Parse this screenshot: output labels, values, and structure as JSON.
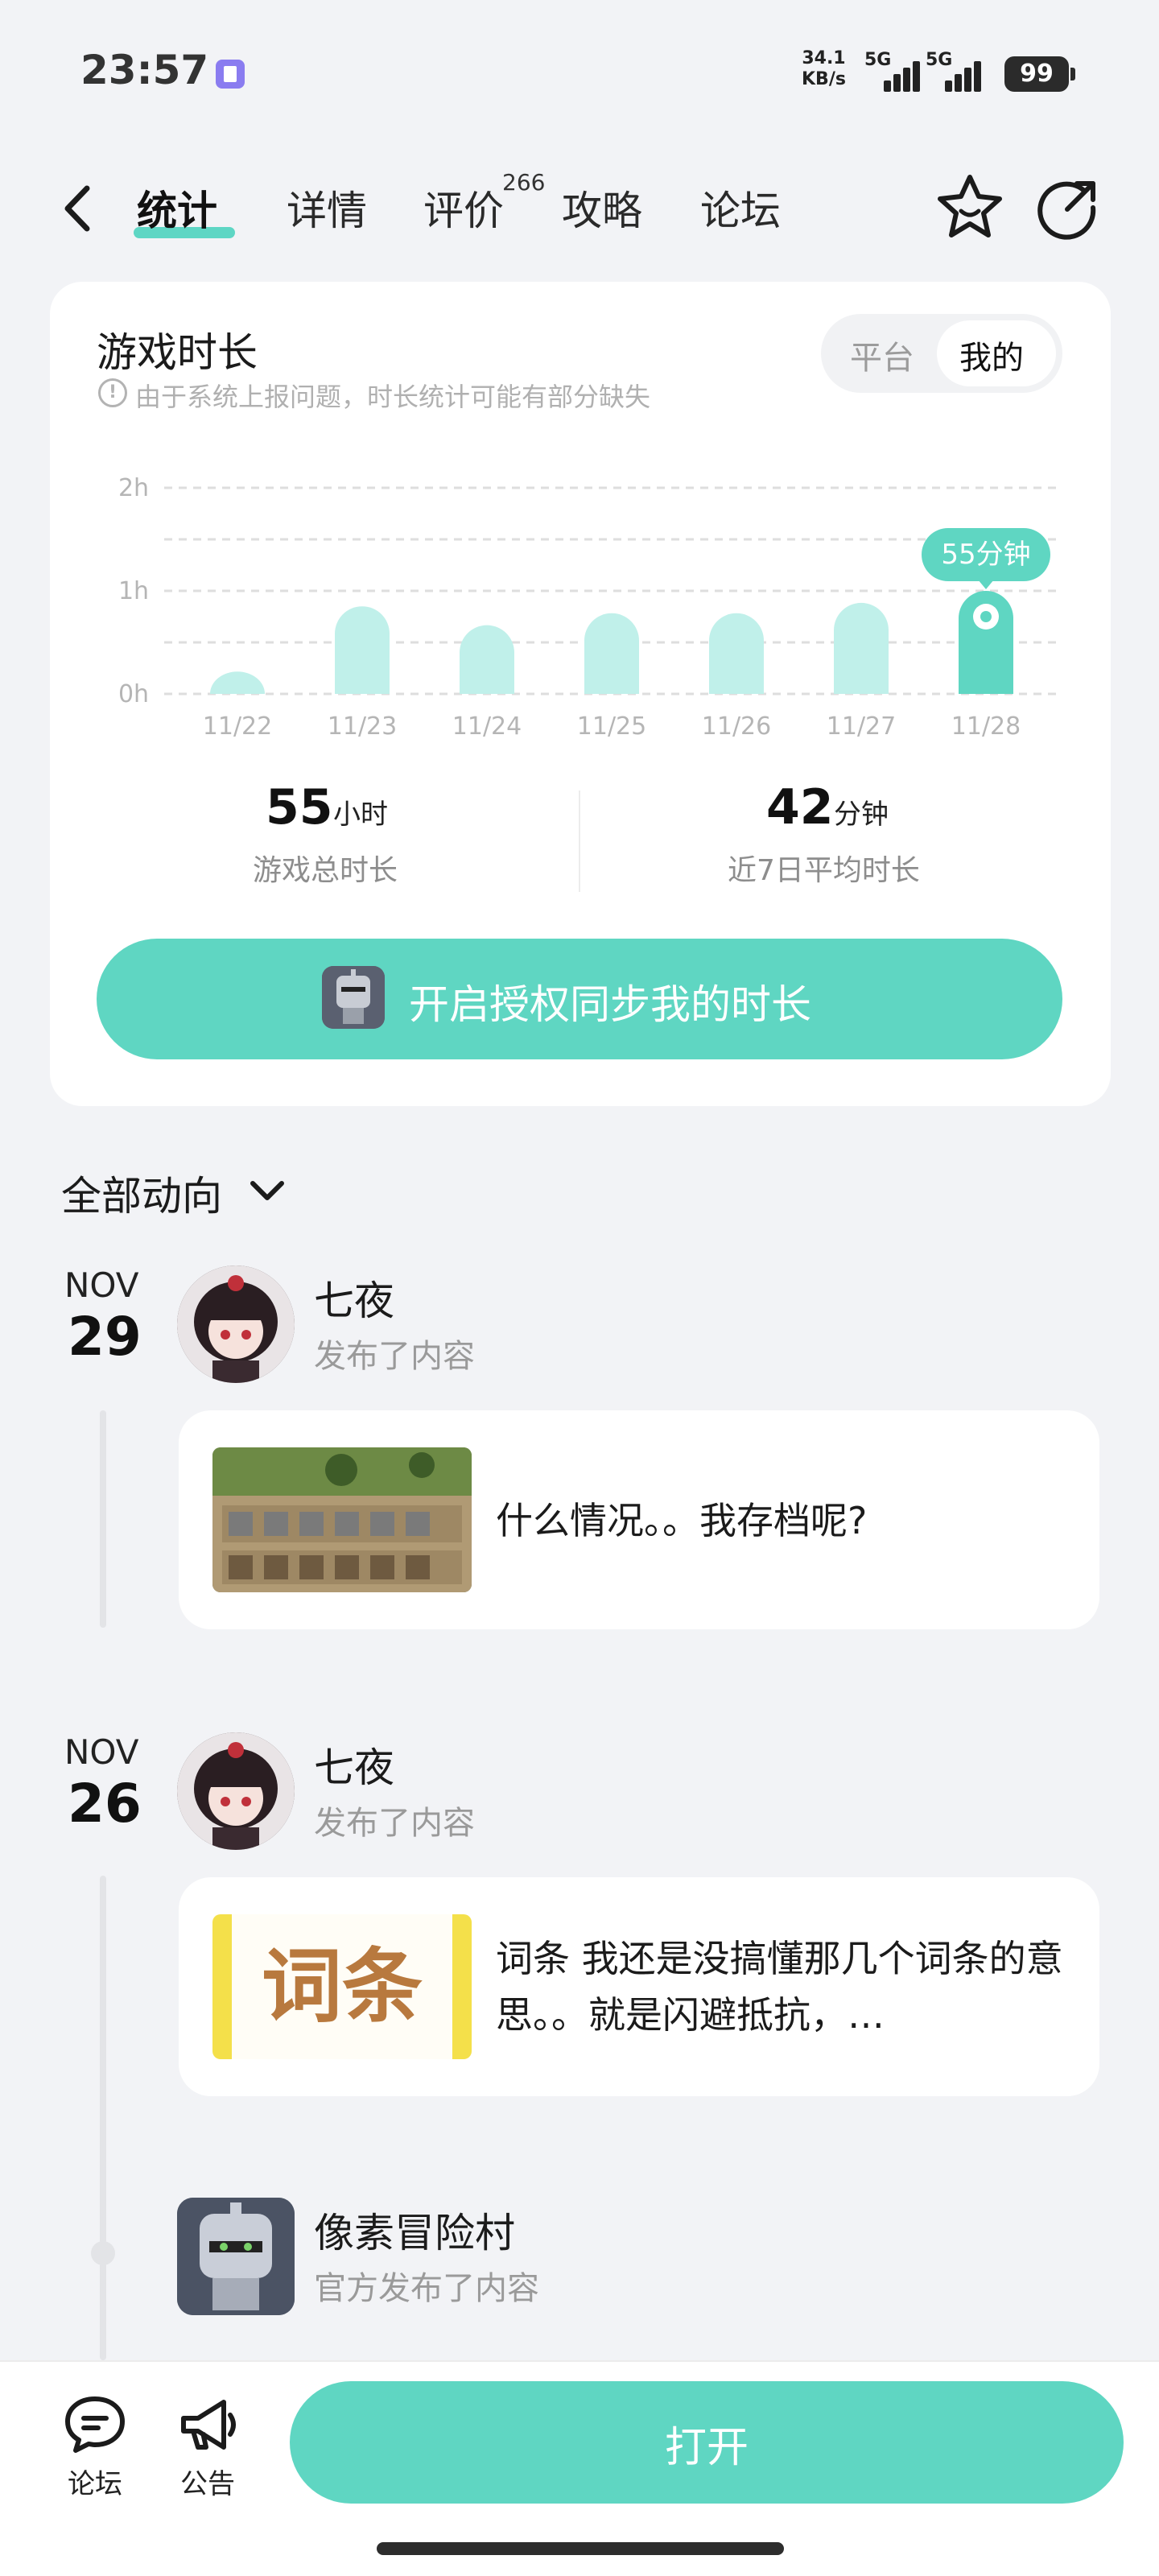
{
  "status_bar": {
    "time": "23:57",
    "net_speed_value": "34.1",
    "net_speed_unit": "KB/s",
    "signal1_label": "5G",
    "signal2_label": "5G",
    "battery": "99"
  },
  "nav": {
    "tabs": [
      {
        "label": "统计",
        "active": true
      },
      {
        "label": "详情",
        "active": false
      },
      {
        "label": "评价",
        "active": false
      },
      {
        "label": "攻略",
        "active": false
      },
      {
        "label": "论坛",
        "active": false
      }
    ],
    "review_count": "266",
    "icons": {
      "back": "chevron-left-icon",
      "favorite": "star-icon",
      "share": "share-icon"
    }
  },
  "playtime": {
    "title": "游戏时长",
    "notice": "由于系统上报问题，时长统计可能有部分缺失",
    "toggle": {
      "platform": "平台",
      "mine": "我的",
      "selected": "我的"
    },
    "total_value": "55",
    "total_unit": "小时",
    "total_label": "游戏总时长",
    "avg_value": "42",
    "avg_unit": "分钟",
    "avg_label": "近7日平均时长",
    "sync_button": "开启授权同步我的时长"
  },
  "chart_data": {
    "type": "bar",
    "title": "游戏时长",
    "categories": [
      "11/22",
      "11/23",
      "11/24",
      "11/25",
      "11/26",
      "11/27",
      "11/28"
    ],
    "values": [
      13,
      51,
      40,
      47,
      47,
      53,
      60
    ],
    "unit": "minutes",
    "y_ticks": [
      "0h",
      "1h",
      "2h"
    ],
    "ylim": [
      0,
      120
    ],
    "highlight_index": 6,
    "highlight_label": "55分钟",
    "grid": "dashed",
    "colors": {
      "bar": "#c0f0ea",
      "highlight": "#5fd6c2",
      "grid": "#dedede",
      "tick": "#b5b5b5"
    }
  },
  "feed": {
    "header": "全部动向",
    "posts": [
      {
        "month": "NOV",
        "day": "29",
        "author": "七夜",
        "action": "发布了内容",
        "text": "什么情况。。我存档呢?"
      },
      {
        "month": "NOV",
        "day": "26",
        "author": "七夜",
        "action": "发布了内容",
        "thumb_text": "词条",
        "text": "词条 我还是没搞懂那几个词条的意思。。就是闪避抵抗，…"
      }
    ],
    "official": {
      "author": "像素冒险村",
      "action": "官方发布了内容"
    }
  },
  "bottom_bar": {
    "forum_label": "论坛",
    "announce_label": "公告",
    "open_button": "打开",
    "icons": {
      "forum": "chat-bubble-icon",
      "announce": "megaphone-icon"
    }
  },
  "colors": {
    "accent": "#5fd6c2",
    "background": "#f2f3f6"
  }
}
